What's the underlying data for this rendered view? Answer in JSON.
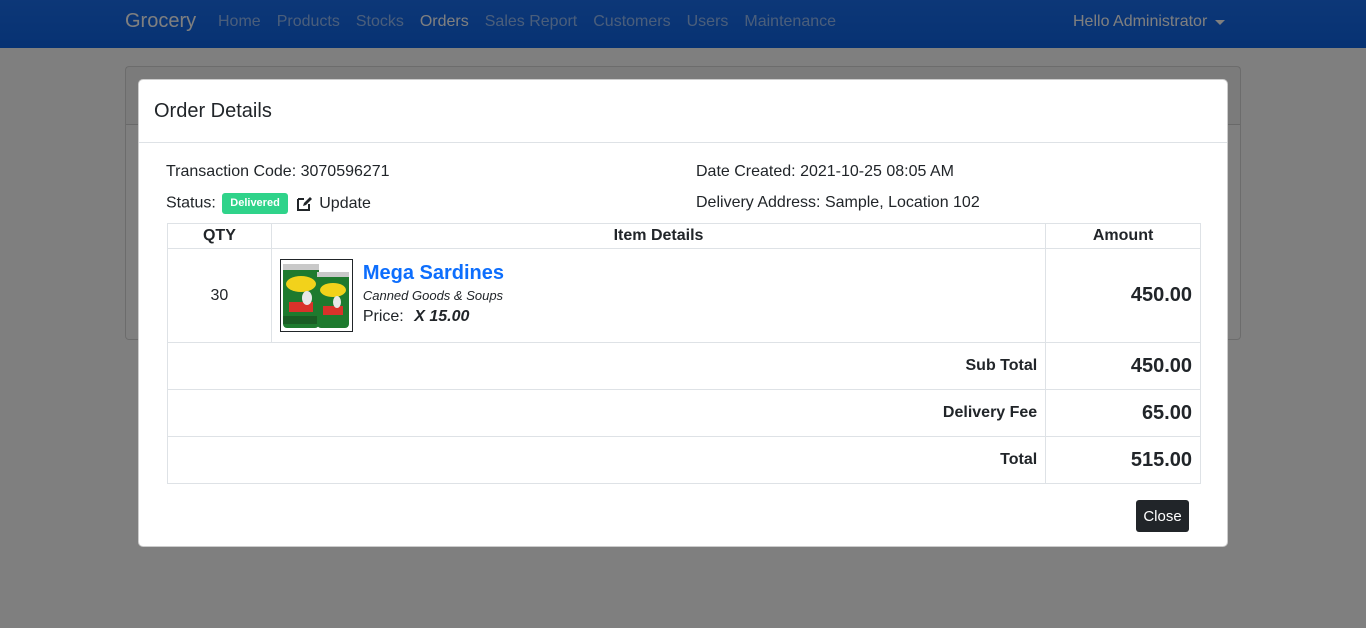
{
  "navbar": {
    "brand": "Grocery",
    "links": [
      "Home",
      "Products",
      "Stocks",
      "Orders",
      "Sales Report",
      "Customers",
      "Users",
      "Maintenance"
    ],
    "active": "Orders",
    "user_greeting": "Hello Administrator"
  },
  "modal": {
    "title": "Order Details",
    "transaction_label": "Transaction Code:",
    "transaction_code": "3070596271",
    "date_label": "Date Created:",
    "date_created": "2021-10-25 08:05 AM",
    "status_label": "Status:",
    "status_badge": "Delivered",
    "update_label": "Update",
    "address_label": "Delivery Address:",
    "delivery_address": "Sample, Location 102",
    "table": {
      "headers": [
        "QTY",
        "Item Details",
        "Amount"
      ],
      "rows": [
        {
          "qty": "30",
          "name": "Mega Sardines",
          "category": "Canned Goods & Soups",
          "price_label": "Price:",
          "price": "X 15.00",
          "amount": "450.00"
        }
      ],
      "summary": [
        {
          "label": "Sub Total",
          "value": "450.00"
        },
        {
          "label": "Delivery Fee",
          "value": "65.00"
        },
        {
          "label": "Total",
          "value": "515.00"
        }
      ]
    },
    "close_label": "Close"
  },
  "colors": {
    "navbar": "#0d6efd",
    "badge_delivered": "#2fd38a",
    "item_link": "#0d6efd",
    "close_button": "#212529"
  },
  "icons": {
    "update": "edit-icon",
    "user_menu": "caret-down-icon",
    "product": "product-image"
  }
}
